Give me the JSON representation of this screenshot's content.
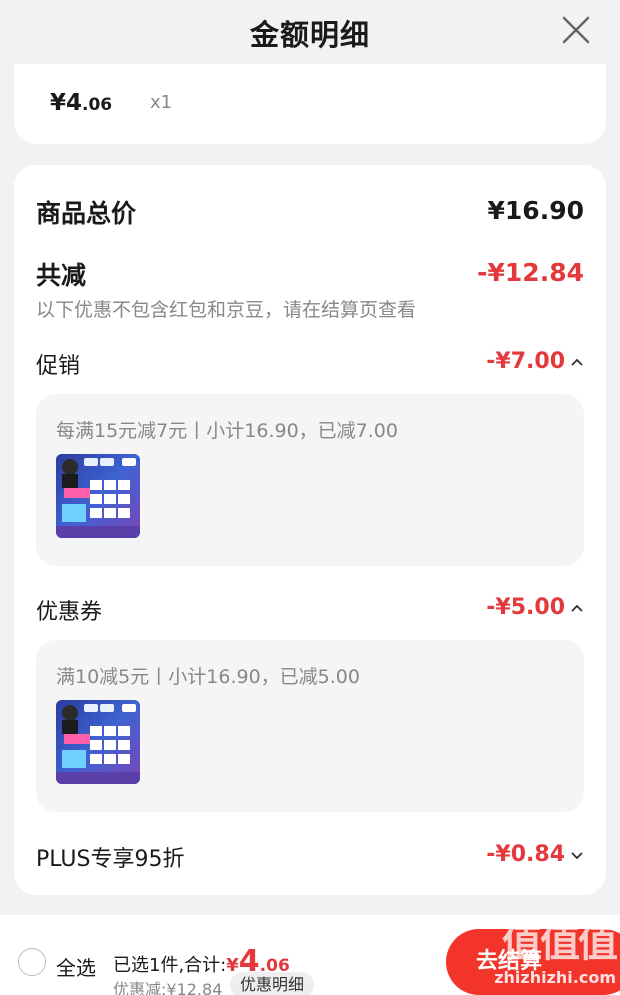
{
  "header": {
    "title": "金额明细",
    "close_icon": "close-icon"
  },
  "top_item": {
    "price_int": "¥4",
    "price_dec": ".06",
    "qty": "x1"
  },
  "summary": {
    "total_label": "商品总价",
    "total_value": "¥16.90",
    "reduce_label": "共减",
    "reduce_value": "-¥12.84",
    "note": "以下优惠不包含红包和京豆，请在结算页查看"
  },
  "sections": {
    "promo": {
      "label": "促销",
      "value": "-¥7.00",
      "desc": "每满15元减7元丨小计16.90，已减7.00"
    },
    "coupon": {
      "label": "优惠券",
      "value": "-¥5.00",
      "desc": "满10减5元丨小计16.90，已减5.00"
    },
    "plus": {
      "label": "PLUS专享95折",
      "value": "-¥0.84"
    }
  },
  "footer": {
    "select_all": "全选",
    "selected_text": "已选1件,合计:",
    "total_sym": "¥",
    "total_int": "4",
    "total_dec": ".06",
    "discount_text": "优惠减:¥12.84",
    "detail_label": "优惠明细",
    "checkout_label": "去结算"
  },
  "watermark": {
    "line1": "值值值",
    "line2": "zhizhizhi.com"
  },
  "colors": {
    "accent_red": "#e4393c",
    "checkout_red": "#f2342a"
  }
}
